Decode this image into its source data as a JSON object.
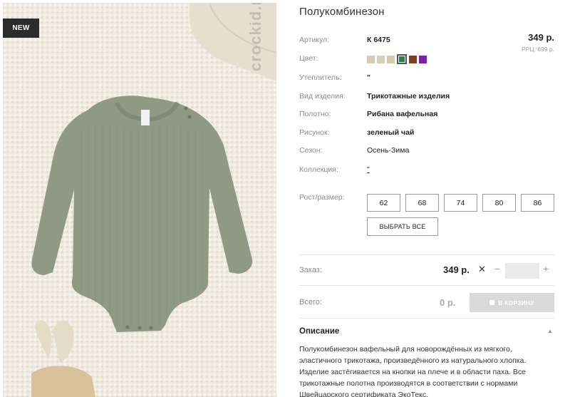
{
  "product": {
    "title": "Полукомбинезон",
    "badge": "NEW",
    "watermark": "crockid.ru"
  },
  "price": {
    "main": "349 р.",
    "rrp": "РРЦ: 699 р."
  },
  "attributes": [
    {
      "label": "Артикул:",
      "value": "К 6475"
    },
    {
      "label": "Цвет:",
      "value": ""
    },
    {
      "label": "Утеплитель:",
      "value": "\""
    },
    {
      "label": "Вид изделия:",
      "value": "Трикотажные изделия"
    },
    {
      "label": "Полотно:",
      "value": "Рибана вафельная"
    },
    {
      "label": "Рисунок:",
      "value": "зеленый чай"
    },
    {
      "label": "Сезон:",
      "value": "Осень-Зима"
    },
    {
      "label": "Коллекция:",
      "value": "\""
    }
  ],
  "colors": [
    "#d9ccb2",
    "#d8cdb8",
    "#d6c9ab",
    "#2e7d4e",
    "#7b4125",
    "#7a1fa6"
  ],
  "selected_color_index": 3,
  "sizes": {
    "label": "Рост/размер:",
    "options": [
      "62",
      "68",
      "74",
      "80",
      "86"
    ],
    "select_all": "ВЫБРАТЬ ВСЕ"
  },
  "order": {
    "label": "Заказ:",
    "price": "349 р.",
    "times": "✕",
    "minus": "−",
    "plus": "+",
    "quantity": ""
  },
  "total": {
    "label": "Всего:",
    "value": "0 р.",
    "cart_button": "В КОРЗИНУ"
  },
  "description": {
    "title": "Описание",
    "toggle": "▲",
    "text": "Полукомбинезон вафельный для новорождённых из мягкого, эластичного трикотажа, произведённого из натурального хлопка. Изделие застёгивается на кнопки на плече и в области паха. Все трикотажные полотна производятся в соответствии с нормами Швейцарского сертификата ЭкоТекс."
  }
}
